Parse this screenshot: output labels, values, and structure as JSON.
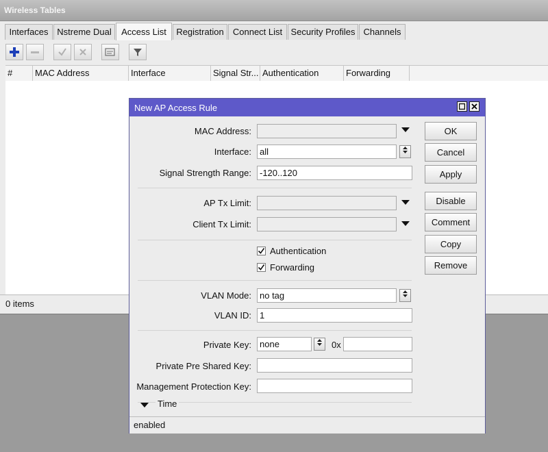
{
  "window": {
    "title": "Wireless Tables"
  },
  "tabs": [
    {
      "label": "Interfaces"
    },
    {
      "label": "Nstreme Dual"
    },
    {
      "label": "Access List"
    },
    {
      "label": "Registration"
    },
    {
      "label": "Connect List"
    },
    {
      "label": "Security Profiles"
    },
    {
      "label": "Channels"
    }
  ],
  "table": {
    "columns": [
      "#",
      "MAC Address",
      "Interface",
      "Signal Str...",
      "Authentication",
      "Forwarding"
    ]
  },
  "status": {
    "items": "0 items"
  },
  "dialog": {
    "title": "New AP Access Rule",
    "fields": {
      "mac_address": {
        "label": "MAC Address:",
        "value": ""
      },
      "interface": {
        "label": "Interface:",
        "value": "all"
      },
      "signal_range": {
        "label": "Signal Strength Range:",
        "value": "-120..120"
      },
      "ap_tx_limit": {
        "label": "AP Tx Limit:",
        "value": ""
      },
      "client_tx_limit": {
        "label": "Client Tx Limit:",
        "value": ""
      },
      "authentication": {
        "label": "Authentication",
        "checked": true
      },
      "forwarding": {
        "label": "Forwarding",
        "checked": true
      },
      "vlan_mode": {
        "label": "VLAN Mode:",
        "value": "no tag"
      },
      "vlan_id": {
        "label": "VLAN ID:",
        "value": "1"
      },
      "private_key": {
        "label": "Private Key:",
        "value": "none",
        "hex_prefix": "0x",
        "hex_value": ""
      },
      "private_psk": {
        "label": "Private Pre Shared Key:",
        "value": ""
      },
      "mgmt_key": {
        "label": "Management Protection Key:",
        "value": ""
      }
    },
    "time_section": "Time",
    "buttons": {
      "ok": "OK",
      "cancel": "Cancel",
      "apply": "Apply",
      "disable": "Disable",
      "comment": "Comment",
      "copy": "Copy",
      "remove": "Remove"
    },
    "status": "enabled"
  },
  "colors": {
    "dialog_title": "#5e59c9",
    "add_icon": "#1d3fb8"
  }
}
